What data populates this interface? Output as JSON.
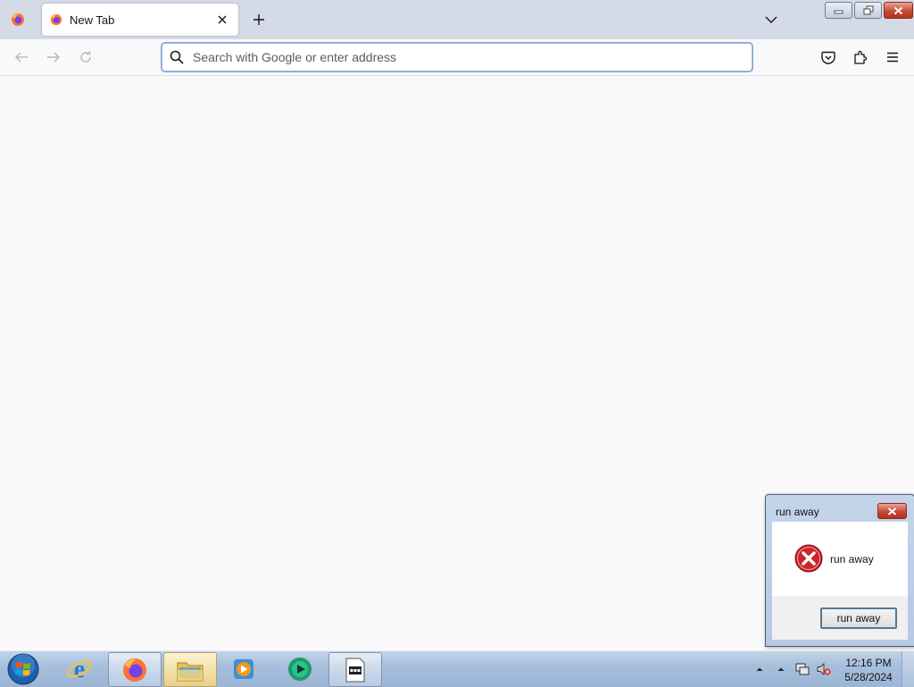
{
  "browser": {
    "tab": {
      "title": "New Tab"
    },
    "urlbar": {
      "placeholder": "Search with Google or enter address",
      "value": ""
    }
  },
  "dialog": {
    "title": "run away",
    "message": "run away",
    "button_label": "run away"
  },
  "taskbar": {
    "pinned": [
      "internet-explorer",
      "firefox",
      "windows-explorer",
      "media-player",
      "green-app",
      "application"
    ],
    "clock": {
      "time": "12:16 PM",
      "date": "5/28/2024"
    }
  },
  "colors": {
    "titlebar": "#d4dbe6",
    "urlbar_focus": "#7da2e0",
    "close_red": "#c74a33",
    "error_icon": "#c8252d",
    "taskbar": "#a7bfdc"
  }
}
